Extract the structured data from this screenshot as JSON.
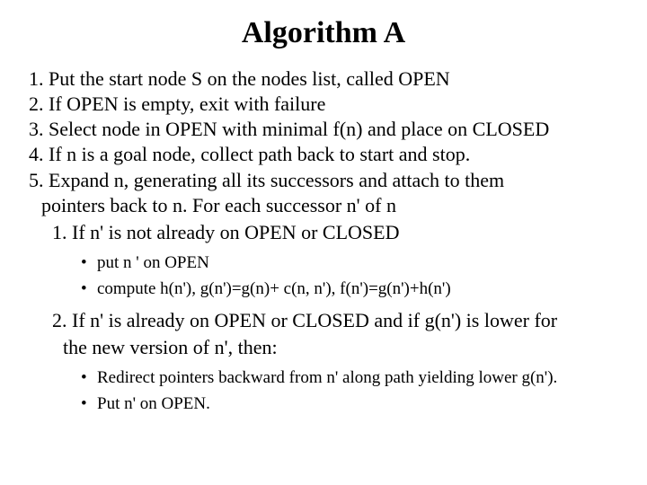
{
  "title": "Algorithm A",
  "steps": {
    "s1": "1. Put the start node S on the nodes list, called OPEN",
    "s2": "2. If OPEN is empty, exit with failure",
    "s3": "3. Select node in OPEN with minimal f(n) and place on CLOSED",
    "s4": "4. If n is a goal node, collect path back to start and stop.",
    "s5a": "5. Expand n, generating all its successors and attach to them",
    "s5b": "pointers back to n.  For each successor n' of n",
    "s5_1": "1. If n' is not already on OPEN or CLOSED",
    "s5_1_b1": "put n ' on OPEN",
    "s5_1_b2": "compute h(n'),  g(n')=g(n)+ c(n, n'),  f(n')=g(n')+h(n')",
    "s5_2a": "2. If n' is already on OPEN or CLOSED and if g(n') is lower for",
    "s5_2b": "the new version of n', then:",
    "s5_2_b1": "Redirect pointers backward from n' along path yielding lower g(n').",
    "s5_2_b2": "Put n' on OPEN."
  }
}
